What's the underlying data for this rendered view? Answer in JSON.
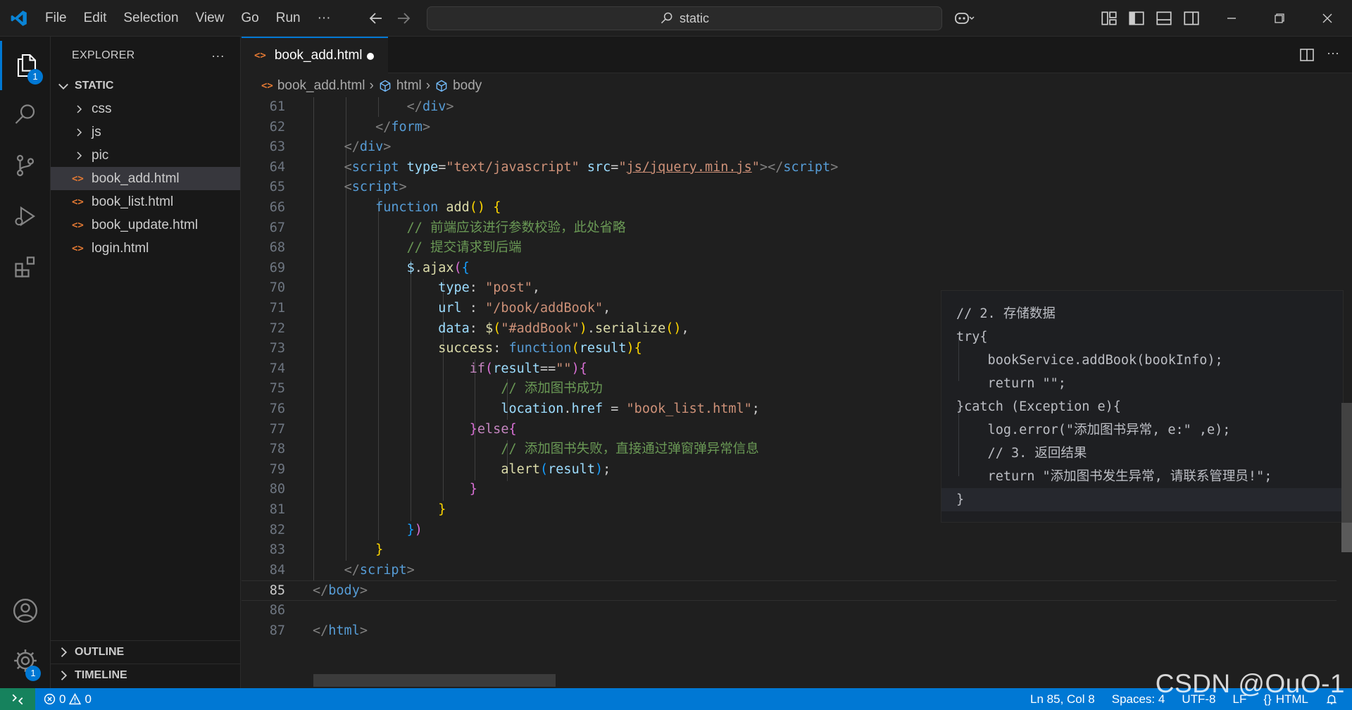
{
  "titlebar": {
    "menu": [
      "File",
      "Edit",
      "Selection",
      "View",
      "Go",
      "Run"
    ],
    "more": "···",
    "search_text": "static"
  },
  "activity": {
    "explorer_badge": "1",
    "settings_badge": "1"
  },
  "sidebar": {
    "title": "EXPLORER",
    "more": "···",
    "section": "STATIC",
    "folders": [
      "css",
      "js",
      "pic"
    ],
    "files": [
      "book_add.html",
      "book_list.html",
      "book_update.html",
      "login.html"
    ],
    "outline": "OUTLINE",
    "timeline": "TIMELINE"
  },
  "editor": {
    "tab_label": "book_add.html",
    "breadcrumb": [
      "book_add.html",
      "html",
      "body"
    ]
  },
  "overlay": {
    "lines": [
      "// 2. 存储数据",
      "try{",
      "    bookService.addBook(bookInfo);",
      "    return \"\";",
      "}catch (Exception e){",
      "    log.error(\"添加图书异常, e:\" ,e);",
      "    // 3. 返回结果",
      "    return \"添加图书发生异常, 请联系管理员!\";",
      "}"
    ]
  },
  "statusbar": {
    "errors": "0",
    "warnings": "0",
    "position": "Ln 85, Col 8",
    "spaces": "Spaces: 4",
    "encoding": "UTF-8",
    "eol": "LF",
    "language": "HTML"
  },
  "watermark": "CSDN @OuO-1",
  "colors": {
    "accent": "#0078d4",
    "remote": "#16825d",
    "html_icon": "#e37933"
  }
}
